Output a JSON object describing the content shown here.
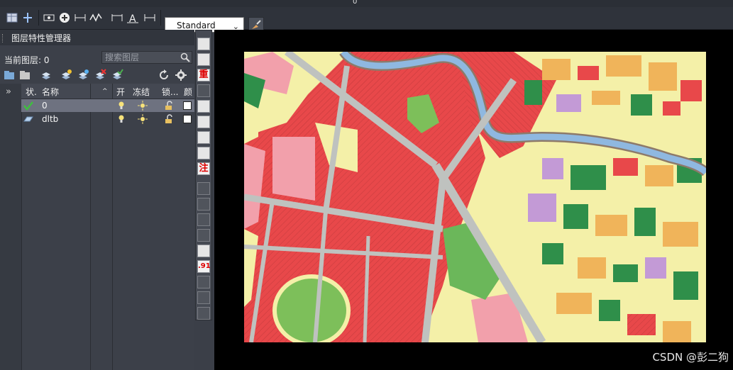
{
  "toolbar": {
    "text_style": "Standard",
    "partial_value": "0"
  },
  "layer_panel": {
    "title": "图层特性管理器",
    "current_layer_label": "当前图层: 0",
    "search_placeholder": "搜索图层",
    "columns": [
      "状.",
      "名称",
      "开",
      "冻结",
      "锁...",
      "颜"
    ],
    "rows": [
      {
        "name": "0",
        "status": "current"
      },
      {
        "name": "dltb",
        "status": "layer"
      }
    ]
  },
  "vertical_toolbar": {
    "labels": [
      "重",
      "注",
      ".91"
    ]
  },
  "watermark": "CSDN @彭二狗",
  "colors": {
    "urban_red": "#e8484a",
    "residential_pink": "#f2a0ab",
    "farmland_yellow": "#f4f0a8",
    "forest_green": "#2f8f4a",
    "park_green": "#7dbf5a",
    "river_blue": "#8fb8e0",
    "road_gray": "#bfc2bf",
    "orchard_orange": "#f0b45a",
    "purple": "#c39ad6"
  }
}
